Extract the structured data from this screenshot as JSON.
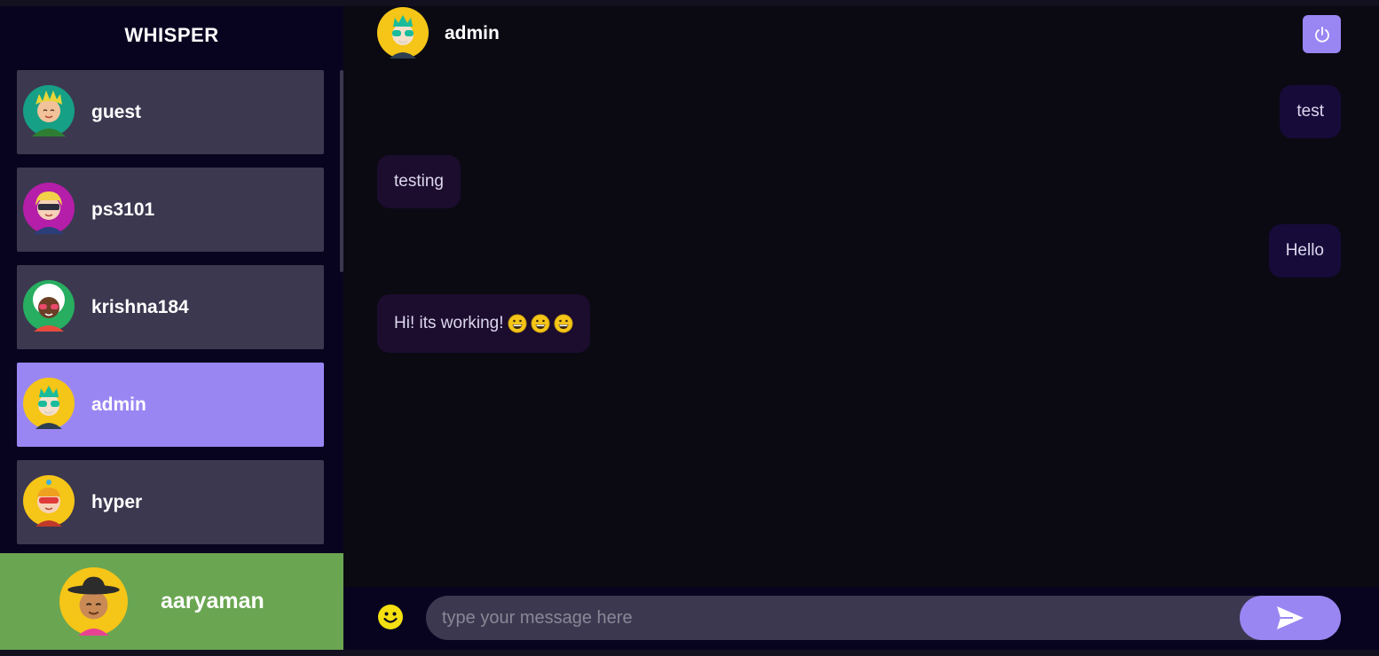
{
  "app": {
    "brand": "WHISPER"
  },
  "contacts": [
    {
      "name": "guest",
      "selected": false
    },
    {
      "name": "ps3101",
      "selected": false
    },
    {
      "name": "krishna184",
      "selected": false
    },
    {
      "name": "admin",
      "selected": true
    },
    {
      "name": "hyper",
      "selected": false
    }
  ],
  "current_user": {
    "name": "aaryaman"
  },
  "chat": {
    "header_name": "admin",
    "messages": [
      {
        "text": "test",
        "direction": "sent"
      },
      {
        "text": "testing",
        "direction": "received"
      },
      {
        "text": "Hello",
        "direction": "sent"
      },
      {
        "text": "Hi! its working!",
        "direction": "received",
        "emojis": [
          "grinning-face",
          "grinning-face",
          "grinning-face"
        ]
      }
    ]
  },
  "composer": {
    "placeholder": "type your message here",
    "value": ""
  },
  "colors": {
    "accent": "#9a86f3",
    "sidebar_bg": "#080420",
    "contact_bg": "#3c3850",
    "chat_bg": "#0b0a13",
    "current_user_bg": "#6aa551",
    "sent_bubble": "#170b3a",
    "received_bubble": "#1c0c2e"
  },
  "icons": {
    "logout": "power-icon",
    "emoji_picker": "smiley-icon",
    "send": "send-icon"
  }
}
